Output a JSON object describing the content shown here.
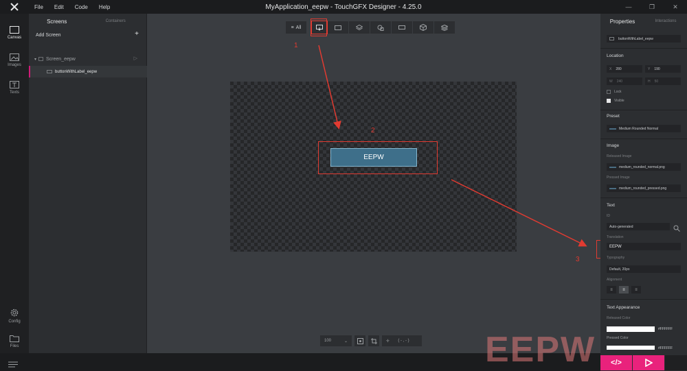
{
  "app": {
    "title": "MyApplication_eepw - TouchGFX Designer - 4.25.0",
    "menu": [
      "File",
      "Edit",
      "Code",
      "Help"
    ],
    "window_controls": [
      "—",
      "❐",
      "✕"
    ]
  },
  "rail": {
    "canvas": "Canvas",
    "images": "Images",
    "texts": "Texts",
    "config": "Config",
    "files": "Files"
  },
  "screens_panel": {
    "tab_screens": "Screens",
    "tab_containers": "Containers",
    "add_screen": "Add Screen",
    "add_plus": "+",
    "screen_name": "Screen_eepw",
    "widget_name": "buttonWithLabel_eepw"
  },
  "toolbar": {
    "all_label": "All"
  },
  "canvas": {
    "button_label": "EEPW"
  },
  "bottom_tools": {
    "zoom": "100",
    "coords": "( - , - )"
  },
  "annotations": {
    "n1": "1",
    "n2": "2",
    "n3": "3"
  },
  "properties": {
    "tab_properties": "Properties",
    "tab_interactions": "Interactions",
    "widget_name": "buttonWithLabel_eepw",
    "location": {
      "title": "Location",
      "x_label": "X",
      "x": "280",
      "y_label": "Y",
      "y": "190",
      "w_label": "W",
      "w": "240",
      "h_label": "H",
      "h": "50",
      "lock": "Lock",
      "visible": "Visible"
    },
    "preset": {
      "title": "Preset",
      "value": "Medium Rounded Normal"
    },
    "image": {
      "title": "Image",
      "released_label": "Released Image",
      "released": "medium_rounded_normal.png",
      "pressed_label": "Pressed Image",
      "pressed": "medium_rounded_pressed.png"
    },
    "text": {
      "title": "Text",
      "id_label": "ID",
      "id": "Auto-generated",
      "translation_label": "Translation",
      "translation": "EEPW",
      "typography_label": "Typography",
      "typography": "Default, 20px",
      "alignment_label": "Alignment"
    },
    "appearance": {
      "title": "Text Appearance",
      "released_color_label": "Released Color",
      "released_color": "#FFFFFF",
      "pressed_color_label": "Pressed Color",
      "pressed_color": "#FFFFFF"
    }
  },
  "run": {
    "code_label": "</>"
  },
  "watermark": "EEPW",
  "colors": {
    "accent": "#e9227c",
    "annotation": "#e23b31",
    "button_fill": "#3e6f8a"
  }
}
